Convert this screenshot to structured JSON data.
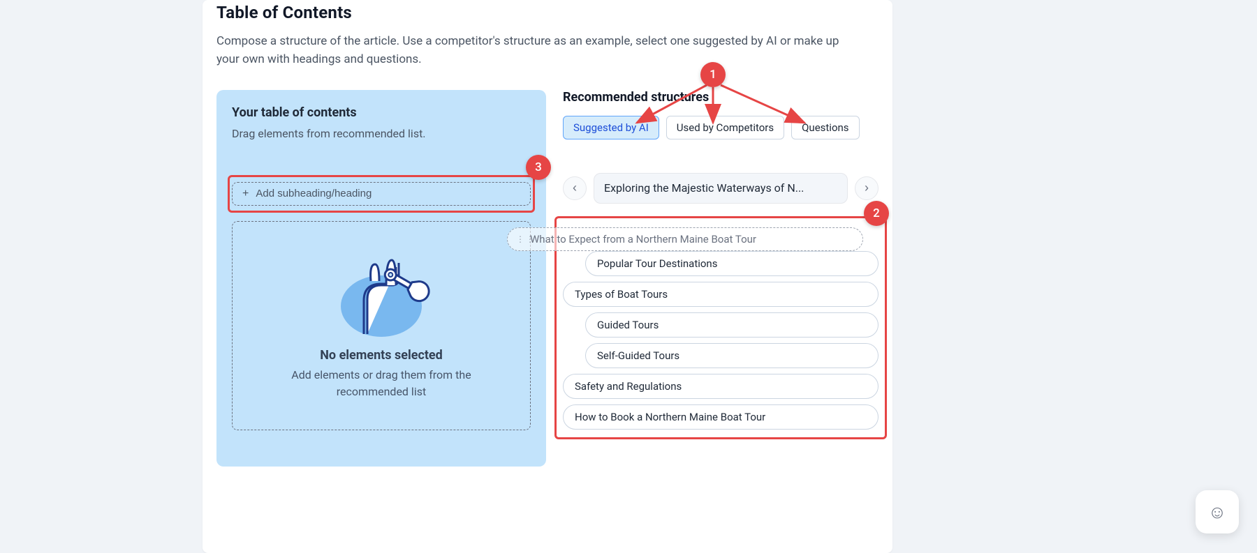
{
  "page": {
    "title": "Table of Contents",
    "description": "Compose a structure of the article. Use a competitor's structure as an example, select one suggested by AI or make up your own with headings and questions."
  },
  "left": {
    "heading": "Your table of contents",
    "subheading": "Drag elements from recommended list.",
    "add_button_label": "Add subheading/heading",
    "empty_title": "No elements selected",
    "empty_description": "Add elements or drag them from the recommended list"
  },
  "right": {
    "heading": "Recommended structures",
    "tabs": {
      "ai": "Suggested by AI",
      "competitors": "Used by Competitors",
      "questions": "Questions"
    },
    "current_structure_title": "Exploring the Majestic Waterways of N...",
    "drag_ghost": "What to Expect from a Northern Maine Boat Tour",
    "items": [
      {
        "type": "sub",
        "label": "Popular Tour Destinations"
      },
      {
        "type": "item",
        "label": "Types of Boat Tours"
      },
      {
        "type": "sub",
        "label": "Guided Tours"
      },
      {
        "type": "sub",
        "label": "Self-Guided Tours"
      },
      {
        "type": "item",
        "label": "Safety and Regulations"
      },
      {
        "type": "item",
        "label": "How to Book a Northern Maine Boat Tour"
      }
    ]
  },
  "annotations": {
    "badge1": "1",
    "badge2": "2",
    "badge3": "3"
  },
  "colors": {
    "accent_blue": "#c2e3fb",
    "annotation_red": "#e64545"
  }
}
